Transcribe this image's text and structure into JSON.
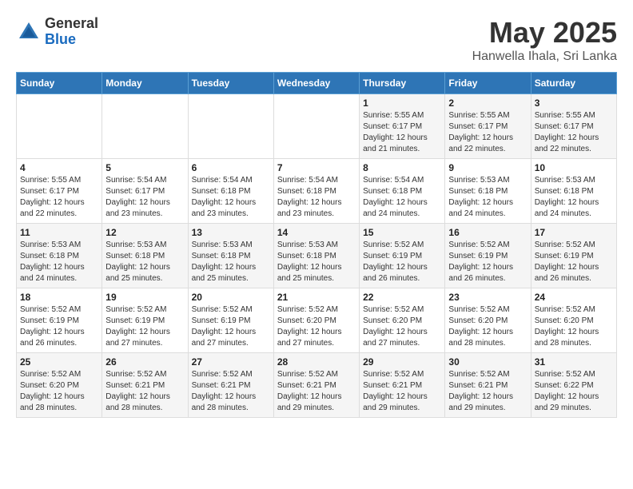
{
  "logo": {
    "general": "General",
    "blue": "Blue"
  },
  "title": "May 2025",
  "subtitle": "Hanwella Ihala, Sri Lanka",
  "days_of_week": [
    "Sunday",
    "Monday",
    "Tuesday",
    "Wednesday",
    "Thursday",
    "Friday",
    "Saturday"
  ],
  "weeks": [
    [
      {
        "day": "",
        "info": ""
      },
      {
        "day": "",
        "info": ""
      },
      {
        "day": "",
        "info": ""
      },
      {
        "day": "",
        "info": ""
      },
      {
        "day": "1",
        "info": "Sunrise: 5:55 AM\nSunset: 6:17 PM\nDaylight: 12 hours\nand 21 minutes."
      },
      {
        "day": "2",
        "info": "Sunrise: 5:55 AM\nSunset: 6:17 PM\nDaylight: 12 hours\nand 22 minutes."
      },
      {
        "day": "3",
        "info": "Sunrise: 5:55 AM\nSunset: 6:17 PM\nDaylight: 12 hours\nand 22 minutes."
      }
    ],
    [
      {
        "day": "4",
        "info": "Sunrise: 5:55 AM\nSunset: 6:17 PM\nDaylight: 12 hours\nand 22 minutes."
      },
      {
        "day": "5",
        "info": "Sunrise: 5:54 AM\nSunset: 6:17 PM\nDaylight: 12 hours\nand 23 minutes."
      },
      {
        "day": "6",
        "info": "Sunrise: 5:54 AM\nSunset: 6:18 PM\nDaylight: 12 hours\nand 23 minutes."
      },
      {
        "day": "7",
        "info": "Sunrise: 5:54 AM\nSunset: 6:18 PM\nDaylight: 12 hours\nand 23 minutes."
      },
      {
        "day": "8",
        "info": "Sunrise: 5:54 AM\nSunset: 6:18 PM\nDaylight: 12 hours\nand 24 minutes."
      },
      {
        "day": "9",
        "info": "Sunrise: 5:53 AM\nSunset: 6:18 PM\nDaylight: 12 hours\nand 24 minutes."
      },
      {
        "day": "10",
        "info": "Sunrise: 5:53 AM\nSunset: 6:18 PM\nDaylight: 12 hours\nand 24 minutes."
      }
    ],
    [
      {
        "day": "11",
        "info": "Sunrise: 5:53 AM\nSunset: 6:18 PM\nDaylight: 12 hours\nand 24 minutes."
      },
      {
        "day": "12",
        "info": "Sunrise: 5:53 AM\nSunset: 6:18 PM\nDaylight: 12 hours\nand 25 minutes."
      },
      {
        "day": "13",
        "info": "Sunrise: 5:53 AM\nSunset: 6:18 PM\nDaylight: 12 hours\nand 25 minutes."
      },
      {
        "day": "14",
        "info": "Sunrise: 5:53 AM\nSunset: 6:18 PM\nDaylight: 12 hours\nand 25 minutes."
      },
      {
        "day": "15",
        "info": "Sunrise: 5:52 AM\nSunset: 6:19 PM\nDaylight: 12 hours\nand 26 minutes."
      },
      {
        "day": "16",
        "info": "Sunrise: 5:52 AM\nSunset: 6:19 PM\nDaylight: 12 hours\nand 26 minutes."
      },
      {
        "day": "17",
        "info": "Sunrise: 5:52 AM\nSunset: 6:19 PM\nDaylight: 12 hours\nand 26 minutes."
      }
    ],
    [
      {
        "day": "18",
        "info": "Sunrise: 5:52 AM\nSunset: 6:19 PM\nDaylight: 12 hours\nand 26 minutes."
      },
      {
        "day": "19",
        "info": "Sunrise: 5:52 AM\nSunset: 6:19 PM\nDaylight: 12 hours\nand 27 minutes."
      },
      {
        "day": "20",
        "info": "Sunrise: 5:52 AM\nSunset: 6:19 PM\nDaylight: 12 hours\nand 27 minutes."
      },
      {
        "day": "21",
        "info": "Sunrise: 5:52 AM\nSunset: 6:20 PM\nDaylight: 12 hours\nand 27 minutes."
      },
      {
        "day": "22",
        "info": "Sunrise: 5:52 AM\nSunset: 6:20 PM\nDaylight: 12 hours\nand 27 minutes."
      },
      {
        "day": "23",
        "info": "Sunrise: 5:52 AM\nSunset: 6:20 PM\nDaylight: 12 hours\nand 28 minutes."
      },
      {
        "day": "24",
        "info": "Sunrise: 5:52 AM\nSunset: 6:20 PM\nDaylight: 12 hours\nand 28 minutes."
      }
    ],
    [
      {
        "day": "25",
        "info": "Sunrise: 5:52 AM\nSunset: 6:20 PM\nDaylight: 12 hours\nand 28 minutes."
      },
      {
        "day": "26",
        "info": "Sunrise: 5:52 AM\nSunset: 6:21 PM\nDaylight: 12 hours\nand 28 minutes."
      },
      {
        "day": "27",
        "info": "Sunrise: 5:52 AM\nSunset: 6:21 PM\nDaylight: 12 hours\nand 28 minutes."
      },
      {
        "day": "28",
        "info": "Sunrise: 5:52 AM\nSunset: 6:21 PM\nDaylight: 12 hours\nand 29 minutes."
      },
      {
        "day": "29",
        "info": "Sunrise: 5:52 AM\nSunset: 6:21 PM\nDaylight: 12 hours\nand 29 minutes."
      },
      {
        "day": "30",
        "info": "Sunrise: 5:52 AM\nSunset: 6:21 PM\nDaylight: 12 hours\nand 29 minutes."
      },
      {
        "day": "31",
        "info": "Sunrise: 5:52 AM\nSunset: 6:22 PM\nDaylight: 12 hours\nand 29 minutes."
      }
    ]
  ]
}
